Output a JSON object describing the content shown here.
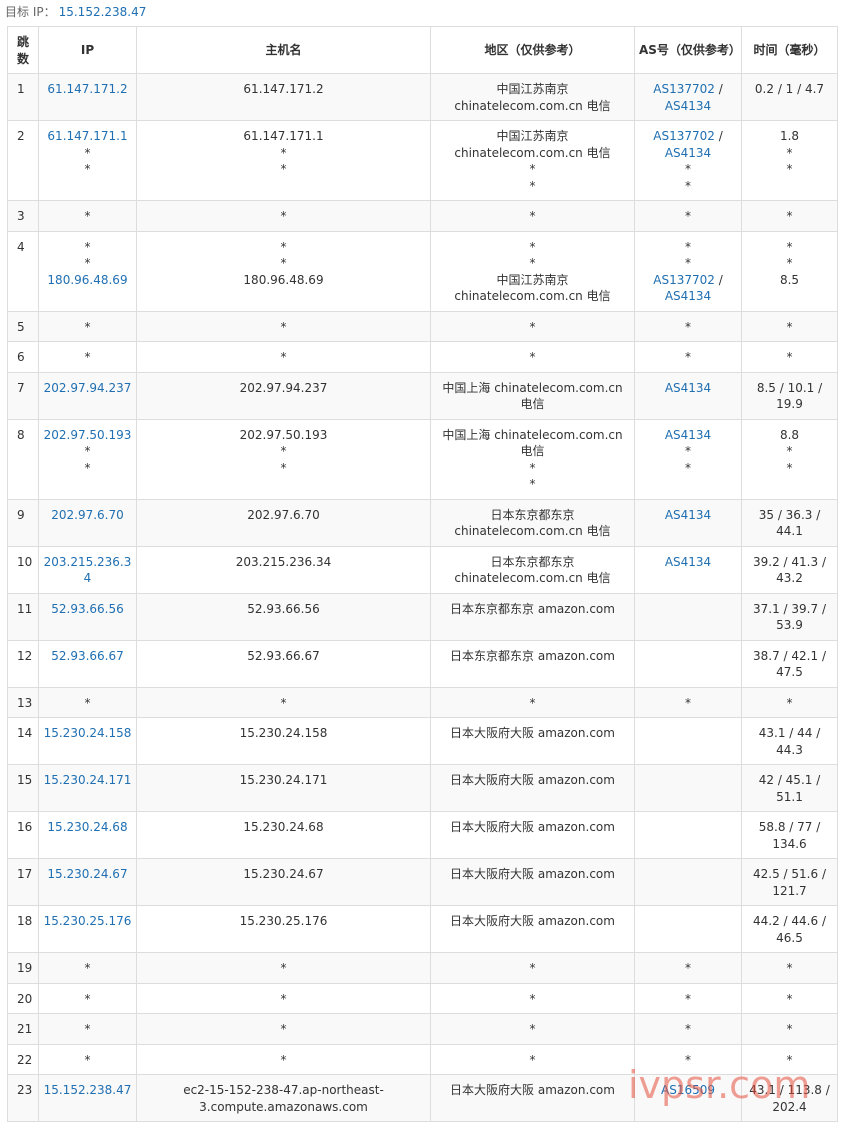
{
  "target": {
    "label": "目标 IP：",
    "ip": "15.152.238.47"
  },
  "columns": [
    "跳数",
    "IP",
    "主机名",
    "地区（仅供参考）",
    "AS号（仅供参考）",
    "时间（毫秒）"
  ],
  "hops": [
    {
      "hop": "1",
      "ip": [
        "61.147.171.2"
      ],
      "host": [
        "61.147.171.2"
      ],
      "region": [
        "中国江苏南京 chinatelecom.com.cn 电信"
      ],
      "as": [
        [
          "AS137702",
          "AS4134"
        ]
      ],
      "time": [
        "0.2 / 1 / 4.7"
      ]
    },
    {
      "hop": "2",
      "ip": [
        "61.147.171.1",
        "*",
        "*"
      ],
      "host": [
        "61.147.171.1",
        "*",
        "*"
      ],
      "region": [
        "中国江苏南京 chinatelecom.com.cn 电信",
        "*",
        "*"
      ],
      "as": [
        [
          "AS137702",
          "AS4134"
        ],
        "*",
        "*"
      ],
      "time": [
        "1.8",
        "*",
        "*"
      ]
    },
    {
      "hop": "3",
      "ip": [
        "*"
      ],
      "host": [
        "*"
      ],
      "region": [
        "*"
      ],
      "as": [
        "*"
      ],
      "time": [
        "*"
      ]
    },
    {
      "hop": "4",
      "ip": [
        "*",
        "*",
        "180.96.48.69"
      ],
      "host": [
        "*",
        "*",
        "180.96.48.69"
      ],
      "region": [
        "*",
        "*",
        "中国江苏南京 chinatelecom.com.cn 电信"
      ],
      "as": [
        "*",
        "*",
        [
          "AS137702",
          "AS4134"
        ]
      ],
      "time": [
        "*",
        "*",
        "8.5"
      ]
    },
    {
      "hop": "5",
      "ip": [
        "*"
      ],
      "host": [
        "*"
      ],
      "region": [
        "*"
      ],
      "as": [
        "*"
      ],
      "time": [
        "*"
      ]
    },
    {
      "hop": "6",
      "ip": [
        "*"
      ],
      "host": [
        "*"
      ],
      "region": [
        "*"
      ],
      "as": [
        "*"
      ],
      "time": [
        "*"
      ]
    },
    {
      "hop": "7",
      "ip": [
        "202.97.94.237"
      ],
      "host": [
        "202.97.94.237"
      ],
      "region": [
        "中国上海 chinatelecom.com.cn 电信"
      ],
      "as": [
        [
          "AS4134"
        ]
      ],
      "time": [
        "8.5 / 10.1 / 19.9"
      ]
    },
    {
      "hop": "8",
      "ip": [
        "202.97.50.193",
        "*",
        "*"
      ],
      "host": [
        "202.97.50.193",
        "*",
        "*"
      ],
      "region": [
        "中国上海 chinatelecom.com.cn 电信",
        "*",
        "*"
      ],
      "as": [
        [
          "AS4134"
        ],
        "*",
        "*"
      ],
      "time": [
        "8.8",
        "*",
        "*"
      ]
    },
    {
      "hop": "9",
      "ip": [
        "202.97.6.70"
      ],
      "host": [
        "202.97.6.70"
      ],
      "region": [
        "日本东京都东京 chinatelecom.com.cn 电信"
      ],
      "as": [
        [
          "AS4134"
        ]
      ],
      "time": [
        "35 / 36.3 / 44.1"
      ]
    },
    {
      "hop": "10",
      "ip": [
        "203.215.236.34"
      ],
      "host": [
        "203.215.236.34"
      ],
      "region": [
        "日本东京都东京 chinatelecom.com.cn 电信"
      ],
      "as": [
        [
          "AS4134"
        ]
      ],
      "time": [
        "39.2 / 41.3 / 43.2"
      ]
    },
    {
      "hop": "11",
      "ip": [
        "52.93.66.56"
      ],
      "host": [
        "52.93.66.56"
      ],
      "region": [
        "日本东京都东京 amazon.com"
      ],
      "as": [
        ""
      ],
      "time": [
        "37.1 / 39.7 / 53.9"
      ]
    },
    {
      "hop": "12",
      "ip": [
        "52.93.66.67"
      ],
      "host": [
        "52.93.66.67"
      ],
      "region": [
        "日本东京都东京 amazon.com"
      ],
      "as": [
        ""
      ],
      "time": [
        "38.7 / 42.1 / 47.5"
      ]
    },
    {
      "hop": "13",
      "ip": [
        "*"
      ],
      "host": [
        "*"
      ],
      "region": [
        "*"
      ],
      "as": [
        "*"
      ],
      "time": [
        "*"
      ]
    },
    {
      "hop": "14",
      "ip": [
        "15.230.24.158"
      ],
      "host": [
        "15.230.24.158"
      ],
      "region": [
        "日本大阪府大阪 amazon.com"
      ],
      "as": [
        ""
      ],
      "time": [
        "43.1 / 44 / 44.3"
      ]
    },
    {
      "hop": "15",
      "ip": [
        "15.230.24.171"
      ],
      "host": [
        "15.230.24.171"
      ],
      "region": [
        "日本大阪府大阪 amazon.com"
      ],
      "as": [
        ""
      ],
      "time": [
        "42 / 45.1 / 51.1"
      ]
    },
    {
      "hop": "16",
      "ip": [
        "15.230.24.68"
      ],
      "host": [
        "15.230.24.68"
      ],
      "region": [
        "日本大阪府大阪 amazon.com"
      ],
      "as": [
        ""
      ],
      "time": [
        "58.8 / 77 / 134.6"
      ]
    },
    {
      "hop": "17",
      "ip": [
        "15.230.24.67"
      ],
      "host": [
        "15.230.24.67"
      ],
      "region": [
        "日本大阪府大阪 amazon.com"
      ],
      "as": [
        ""
      ],
      "time": [
        "42.5 / 51.6 / 121.7"
      ]
    },
    {
      "hop": "18",
      "ip": [
        "15.230.25.176"
      ],
      "host": [
        "15.230.25.176"
      ],
      "region": [
        "日本大阪府大阪 amazon.com"
      ],
      "as": [
        ""
      ],
      "time": [
        "44.2 / 44.6 / 46.5"
      ]
    },
    {
      "hop": "19",
      "ip": [
        "*"
      ],
      "host": [
        "*"
      ],
      "region": [
        "*"
      ],
      "as": [
        "*"
      ],
      "time": [
        "*"
      ]
    },
    {
      "hop": "20",
      "ip": [
        "*"
      ],
      "host": [
        "*"
      ],
      "region": [
        "*"
      ],
      "as": [
        "*"
      ],
      "time": [
        "*"
      ]
    },
    {
      "hop": "21",
      "ip": [
        "*"
      ],
      "host": [
        "*"
      ],
      "region": [
        "*"
      ],
      "as": [
        "*"
      ],
      "time": [
        "*"
      ]
    },
    {
      "hop": "22",
      "ip": [
        "*"
      ],
      "host": [
        "*"
      ],
      "region": [
        "*"
      ],
      "as": [
        "*"
      ],
      "time": [
        "*"
      ]
    },
    {
      "hop": "23",
      "ip": [
        "15.152.238.47"
      ],
      "host": [
        "ec2-15-152-238-47.ap-northeast-3.compute.amazonaws.com"
      ],
      "region": [
        "日本大阪府大阪 amazon.com"
      ],
      "as": [
        [
          "AS16509"
        ]
      ],
      "time": [
        "43.1 / 113.8 / 202.4"
      ]
    }
  ],
  "watermark": "ivpsr.com",
  "colors": {
    "link": "#1f6fb2",
    "text": "#333333",
    "border": "#dddddd",
    "stripe": "#f9f9f9",
    "watermark": "#e6503c"
  }
}
